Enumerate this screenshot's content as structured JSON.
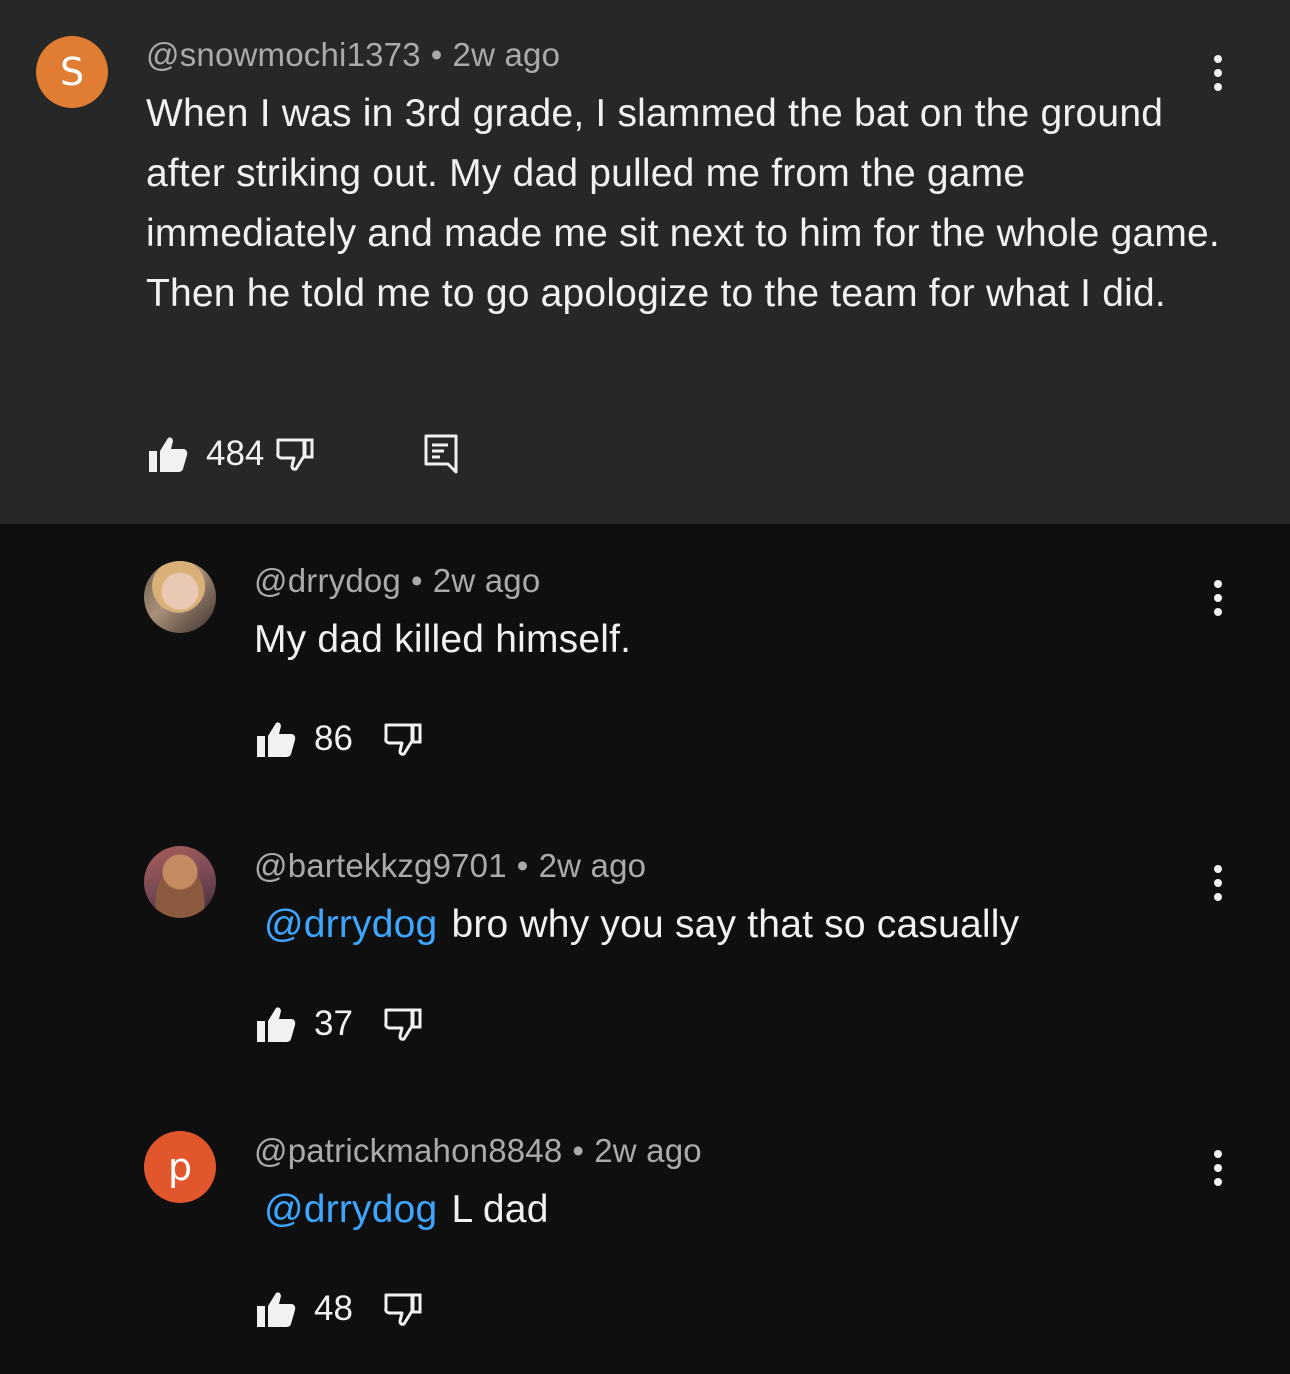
{
  "comments": [
    {
      "avatar_letter": "S",
      "handle": "@snowmochi1373",
      "separator": "•",
      "time": "2w ago",
      "mention": "",
      "text": "When I was in 3rd grade, I slammed the bat on the ground after striking out. My dad pulled me from the game immediately and made me sit next to him for the whole game. Then he told me to go apologize to the team for what I did.",
      "likes": "484",
      "icons": {
        "like": "thumbs-up-icon",
        "dislike": "thumbs-down-icon",
        "reply": "reply-icon",
        "more": "more-vert-icon"
      }
    },
    {
      "avatar_letter": "",
      "handle": "@drrydog",
      "separator": "•",
      "time": "2w ago",
      "mention": "",
      "text": "My dad killed himself.",
      "likes": "86"
    },
    {
      "avatar_letter": "",
      "handle": "@bartekkzg9701",
      "separator": "•",
      "time": "2w ago",
      "mention": "@drrydog",
      "text": "bro why you say that so casually",
      "likes": "37"
    },
    {
      "avatar_letter": "p",
      "handle": "@patrickmahon8848",
      "separator": "•",
      "time": "2w ago",
      "mention": "@drrydog",
      "text": "L dad",
      "likes": "48"
    }
  ],
  "colors": {
    "background": "#0f0f0f",
    "highlight_background": "#272727",
    "mention": "#3ea6ff",
    "meta_text": "#aaaaaa",
    "avatar_s": "#e07d33",
    "avatar_p": "#e2562e"
  }
}
